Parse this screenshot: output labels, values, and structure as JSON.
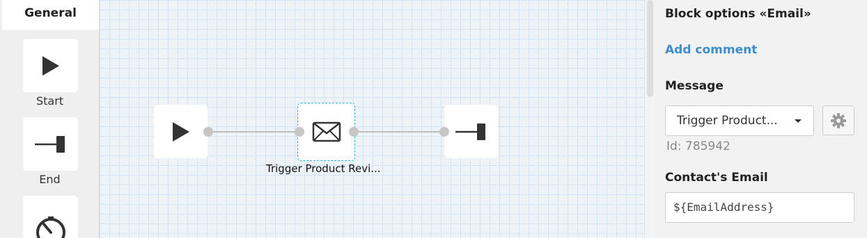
{
  "palette": {
    "tab_label": "General",
    "items": [
      {
        "label": "Start",
        "icon": "play-icon"
      },
      {
        "label": "End",
        "icon": "end-icon"
      },
      {
        "label": "",
        "icon": "timer-icon"
      }
    ]
  },
  "canvas": {
    "nodes": [
      {
        "type": "start",
        "icon": "play-icon"
      },
      {
        "type": "email",
        "icon": "envelope-icon",
        "caption": "Trigger Product Revi..."
      },
      {
        "type": "end",
        "icon": "end-icon"
      }
    ]
  },
  "panel": {
    "title": "Block options «Email»",
    "add_comment": "Add comment",
    "message_label": "Message",
    "message_value": "Trigger Product...",
    "id_text": "Id: 785942",
    "email_label": "Contact's Email",
    "email_value": "${EmailAddress}"
  },
  "colors": {
    "link": "#3d8ecb",
    "selection": "#26b0d6",
    "canvas_bg": "#eef3f8",
    "grid": "#d3e3f1"
  }
}
